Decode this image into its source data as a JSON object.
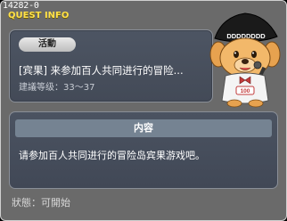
{
  "window": {
    "quest_id": "14282-0",
    "title": "QUEST INFO"
  },
  "summary": {
    "badge": "活動",
    "quest_title": "[宾果] 来参加百人共同进行的冒险...",
    "level_label": "建議等级：33～37"
  },
  "npc": {
    "hat_text": "DDDDDDDD",
    "icon": "dog-npc-icon",
    "name_tag": "100"
  },
  "detail": {
    "header": "内容",
    "body": "请参加百人共同进行的冒险岛宾果游戏吧。"
  },
  "status": {
    "text": "狀態：可開始"
  },
  "colors": {
    "title_yellow": "#ffe14a",
    "panel": "#4b5361",
    "header_bar": "#758392"
  }
}
